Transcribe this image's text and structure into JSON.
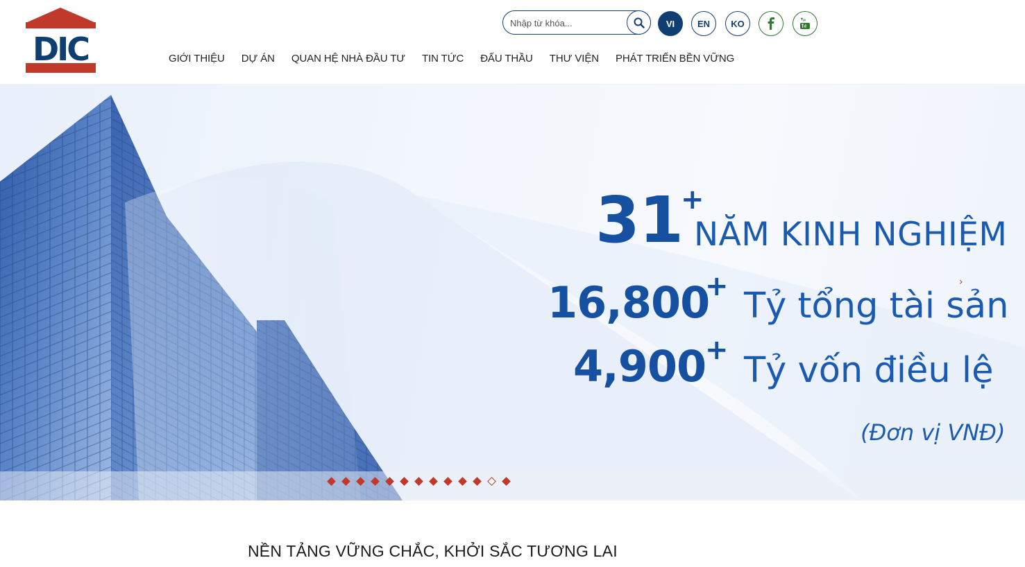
{
  "logo": {
    "text": "DIC"
  },
  "search": {
    "placeholder": "Nhập từ khóa..."
  },
  "languages": [
    {
      "label": "VI",
      "active": true
    },
    {
      "label": "EN",
      "active": false
    },
    {
      "label": "KO",
      "active": false
    }
  ],
  "social": [
    {
      "icon": "facebook-icon"
    },
    {
      "icon": "youtube-icon"
    }
  ],
  "nav": [
    "GIỚI THIỆU",
    "DỰ ÁN",
    "QUAN HỆ NHÀ ĐẦU TƯ",
    "TIN TỨC",
    "ĐẤU THẦU",
    "THƯ VIỆN",
    "PHÁT TRIỂN BỀN VỮNG"
  ],
  "hero": {
    "stat1_value": "31",
    "stat1_plus": "+",
    "stat1_label": "NĂM KINH NGHIỆM",
    "stat2_value": "16,800",
    "stat2_plus": "+",
    "stat2_label": "Tỷ tổng tài sản",
    "stat3_value": "4,900",
    "stat3_plus": "+",
    "stat3_label": "Tỷ vốn điều lệ",
    "unit_note": "(Đơn vị VNĐ)",
    "next_arrow": "›"
  },
  "slider": {
    "total": 13,
    "active_index": 11
  },
  "slogan": "NỀN TẢNG VỮNG CHẮC, KHỞI SẮC TƯƠNG LAI",
  "colors": {
    "brand_blue": "#0f3e73",
    "accent_red": "#c0392b",
    "hero_text": "#1650a0"
  }
}
